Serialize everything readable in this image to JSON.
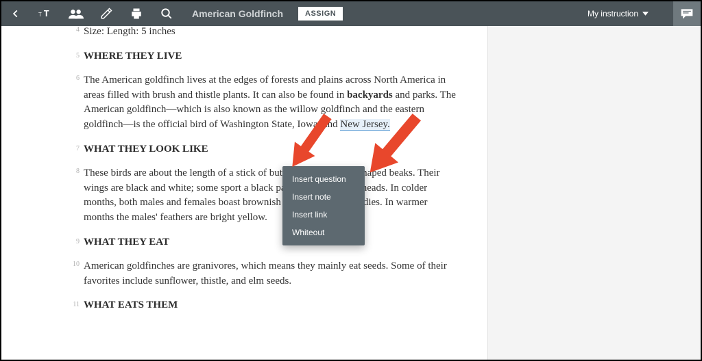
{
  "toolbar": {
    "title": "American Goldfinch",
    "assign": "ASSIGN",
    "instruction": "My instruction"
  },
  "doc": {
    "line4": "Size: Length: 5 inches",
    "line5": "WHERE THEY LIVE",
    "line6_a": "The American goldfinch lives at the edges of forests and plains across North America in areas filled with brush and thistle plants. It can also be found in ",
    "line6_b": "backyards",
    "line6_c": " and parks. The American goldfinch—which is also known as the willow goldfinch and the eastern goldfinch—is the official bird of Washington State, Iowa, and ",
    "line6_d": "New Jersey.",
    "line7": "WHAT THEY LOOK LIKE",
    "line8": "These birds are about the length of a stick of butter and have cone-shaped beaks. Their wings are black and white; some sport a black patch on top of their heads. In colder months, both males and females boast brownish feathers on their bodies. In warmer months the males' feathers are bright yellow.",
    "line9": "WHAT THEY EAT",
    "line10": "American goldfinches are granivores, which means they mainly eat seeds. Some of their favorites include sunflower, thistle, and elm seeds.",
    "line11": "WHAT EATS THEM"
  },
  "menu": {
    "item1": "Insert question",
    "item2": "Insert note",
    "item3": "Insert link",
    "item4": "Whiteout"
  },
  "nums": {
    "n4": "4",
    "n5": "5",
    "n6": "6",
    "n7": "7",
    "n8": "8",
    "n9": "9",
    "n10": "10",
    "n11": "11"
  }
}
